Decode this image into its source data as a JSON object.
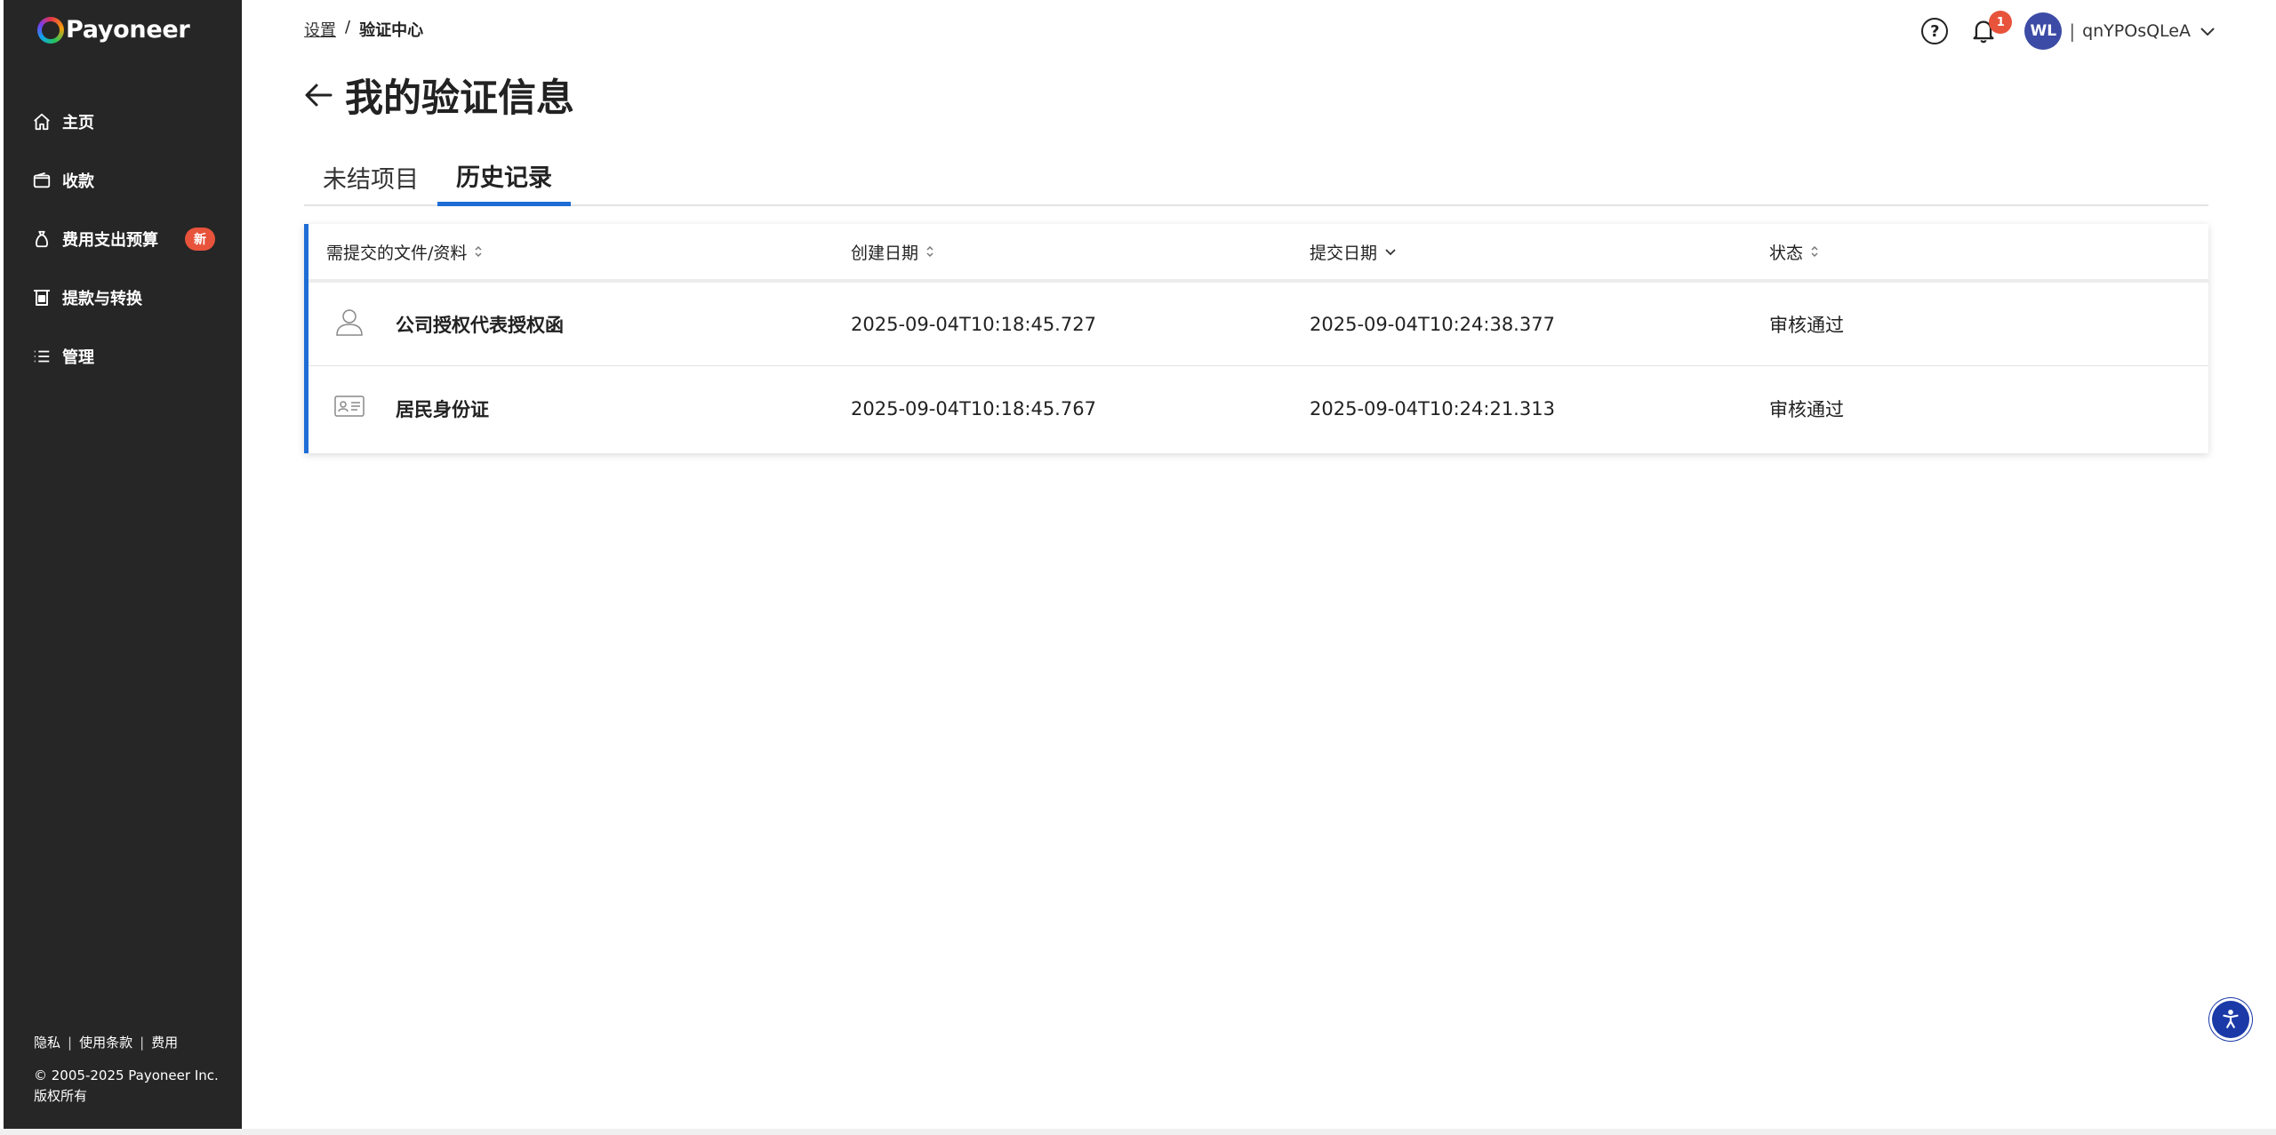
{
  "brand": {
    "name": "Payoneer"
  },
  "sidebar": {
    "items": [
      {
        "label": "主页",
        "icon": "home-icon"
      },
      {
        "label": "收款",
        "icon": "wallet-icon"
      },
      {
        "label": "费用支出预算",
        "icon": "money-bag-icon",
        "badge": "新"
      },
      {
        "label": "提款与转换",
        "icon": "withdraw-icon"
      },
      {
        "label": "管理",
        "icon": "list-icon"
      }
    ],
    "footer": {
      "privacy": "隐私",
      "terms": "使用条款",
      "fees": "费用",
      "separator": "|",
      "copyright": "© 2005-2025 Payoneer Inc.",
      "rights": "版权所有"
    }
  },
  "header": {
    "breadcrumb": {
      "parent": "设置",
      "separator": "/",
      "current": "验证中心"
    },
    "notifications_count": "1",
    "user": {
      "initials": "WL",
      "separator": "|",
      "name": "qnYPOsQLeA"
    }
  },
  "page": {
    "title": "我的验证信息",
    "tabs": [
      {
        "label": "未结项目",
        "active": false
      },
      {
        "label": "历史记录",
        "active": true
      }
    ]
  },
  "table": {
    "columns": [
      "需提交的文件/资料",
      "创建日期",
      "提交日期",
      "状态"
    ],
    "rows": [
      {
        "icon": "person-icon",
        "document": "公司授权代表授权函",
        "created": "2025-09-04T10:18:45.727",
        "submitted": "2025-09-04T10:24:38.377",
        "status": "审核通过"
      },
      {
        "icon": "id-card-icon",
        "document": "居民身份证",
        "created": "2025-09-04T10:18:45.767",
        "submitted": "2025-09-04T10:24:21.313",
        "status": "审核通过"
      }
    ]
  },
  "colors": {
    "accent": "#1e6dd6",
    "sidebar_bg": "#262626",
    "badge": "#e8533b",
    "avatar": "#3c4ba5"
  }
}
